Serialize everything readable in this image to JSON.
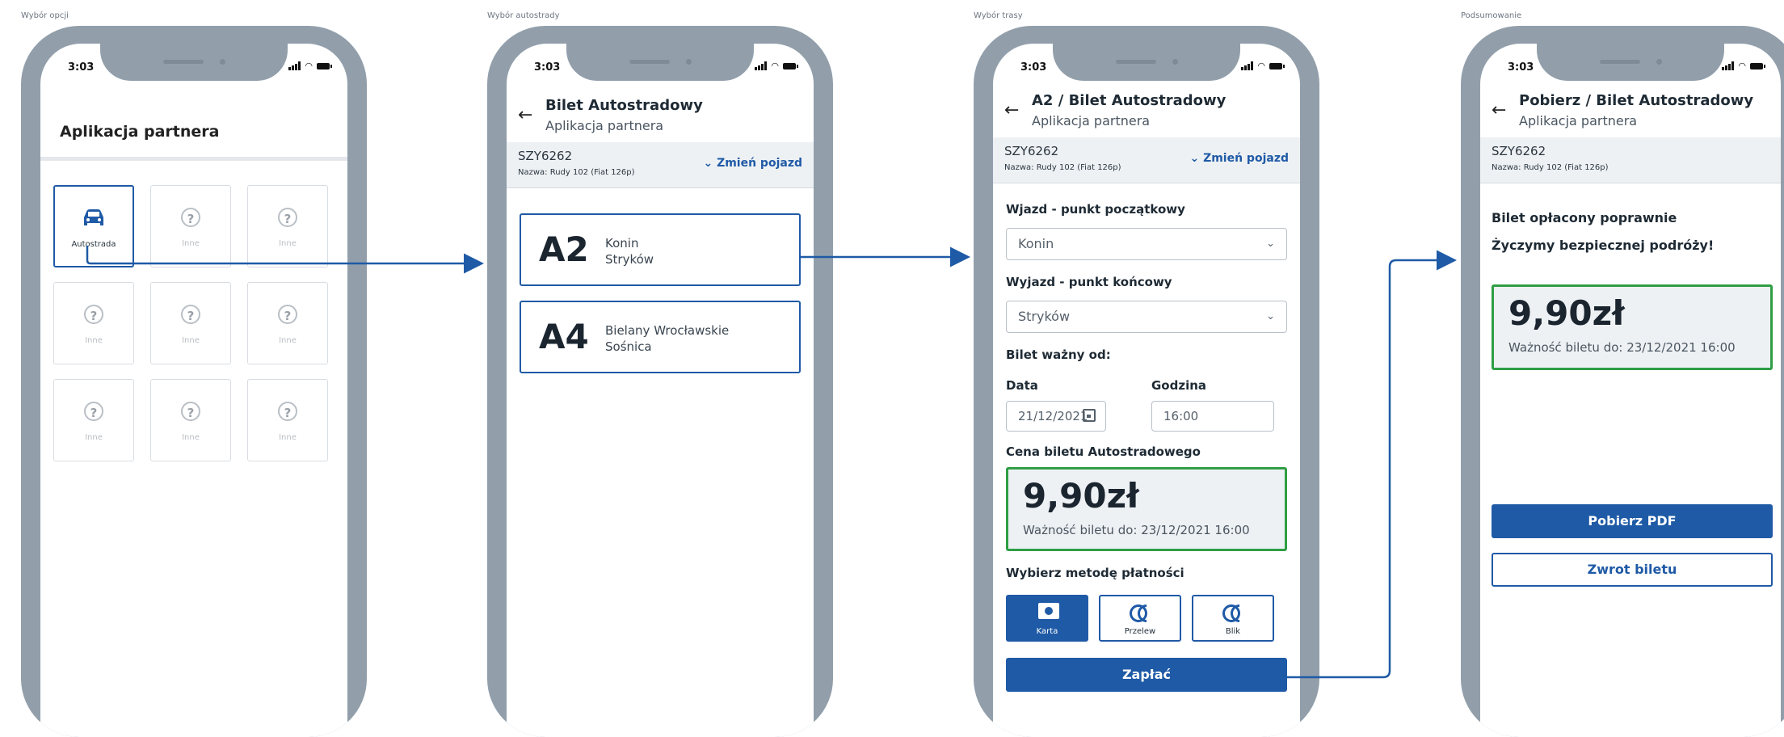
{
  "stages": {
    "s1": "Wybór opcji",
    "s2": "Wybór autostrady",
    "s3": "Wybór trasy",
    "s4": "Podsumowanie"
  },
  "status_time": "3:03",
  "screen1": {
    "title": "Aplikacja partnera",
    "tiles": [
      {
        "label": "Autostrada",
        "icon": "car-icon"
      },
      {
        "label": "Inne",
        "icon": "help-icon"
      },
      {
        "label": "Inne",
        "icon": "help-icon"
      },
      {
        "label": "Inne",
        "icon": "help-icon"
      },
      {
        "label": "Inne",
        "icon": "help-icon"
      },
      {
        "label": "Inne",
        "icon": "help-icon"
      },
      {
        "label": "Inne",
        "icon": "help-icon"
      },
      {
        "label": "Inne",
        "icon": "help-icon"
      },
      {
        "label": "Inne",
        "icon": "help-icon"
      }
    ]
  },
  "screen2": {
    "title": "Bilet Autostradowy",
    "subtitle": "Aplikacja partnera",
    "plate": "SZY6262",
    "vehicle_name": "Nazwa: Rudy 102 (Fiat 126p)",
    "change_vehicle": "Zmień pojazd",
    "roads": [
      {
        "code": "A2",
        "from": "Konin",
        "to": "Stryków"
      },
      {
        "code": "A4",
        "from": "Bielany Wrocławskie",
        "to": "Sośnica"
      }
    ]
  },
  "screen3": {
    "title": "A2 / Bilet Autostradowy",
    "subtitle": "Aplikacja partnera",
    "plate": "SZY6262",
    "vehicle_name": "Nazwa: Rudy 102 (Fiat 126p)",
    "change_vehicle": "Zmień pojazd",
    "entry_label": "Wjazd - punkt początkowy",
    "entry_value": "Konin",
    "exit_label": "Wyjazd - punkt końcowy",
    "exit_value": "Stryków",
    "valid_from_label": "Bilet ważny od:",
    "date_label": "Data",
    "date_value": "21/12/2021",
    "time_label": "Godzina",
    "time_value": "16:00",
    "price_label": "Cena biletu Autostradowego",
    "price": "9,90zł",
    "validity": "Ważność biletu do: 23/12/2021 16:00",
    "payment_label": "Wybierz metodę płatności",
    "payment_methods": [
      "Karta",
      "Przelew",
      "Blik"
    ],
    "pay_button": "Zapłać"
  },
  "screen4": {
    "title": "Pobierz / Bilet Autostradowy",
    "subtitle": "Aplikacja partnera",
    "plate": "SZY6262",
    "vehicle_name": "Nazwa: Rudy 102 (Fiat 126p)",
    "msg1": "Bilet opłacony poprawnie",
    "msg2": "Życzymy bezpiecznej podróży!",
    "price": "9,90zł",
    "validity": "Ważność biletu do: 23/12/2021 16:00",
    "pdf_button": "Pobierz PDF",
    "refund_button": "Zwrot biletu"
  },
  "colors": {
    "accent": "#1f5aa6",
    "success": "#2f9e44",
    "frame": "#929fab"
  }
}
